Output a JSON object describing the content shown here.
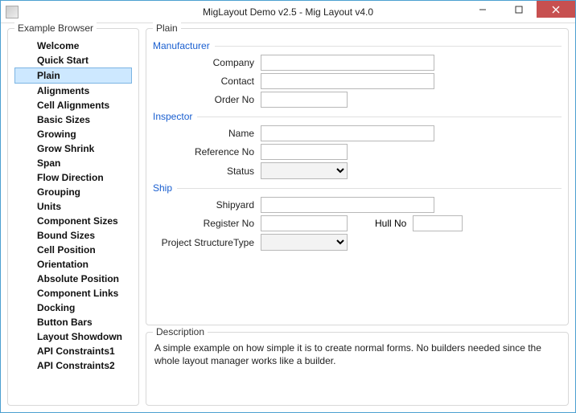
{
  "window": {
    "title": "MigLayout Demo v2.5 - Mig Layout v4.0"
  },
  "sidebar": {
    "legend": "Example Browser",
    "items": [
      "Welcome",
      "Quick Start",
      "Plain",
      "Alignments",
      "Cell Alignments",
      "Basic Sizes",
      "Growing",
      "Grow Shrink",
      "Span",
      "Flow Direction",
      "Grouping",
      "Units",
      "Component Sizes",
      "Bound Sizes",
      "Cell Position",
      "Orientation",
      "Absolute Position",
      "Component Links",
      "Docking",
      "Button Bars",
      "Layout Showdown",
      "API Constraints1",
      "API Constraints2"
    ],
    "selectedIndex": 2
  },
  "plain": {
    "legend": "Plain",
    "manufacturer": {
      "heading": "Manufacturer",
      "company_label": "Company",
      "company_value": "",
      "contact_label": "Contact",
      "contact_value": "",
      "orderno_label": "Order No",
      "orderno_value": ""
    },
    "inspector": {
      "heading": "Inspector",
      "name_label": "Name",
      "name_value": "",
      "refno_label": "Reference No",
      "refno_value": "",
      "status_label": "Status",
      "status_value": ""
    },
    "ship": {
      "heading": "Ship",
      "shipyard_label": "Shipyard",
      "shipyard_value": "",
      "regno_label": "Register No",
      "regno_value": "",
      "hullno_label": "Hull No",
      "hullno_value": "",
      "pst_label": "Project StructureType",
      "pst_value": ""
    }
  },
  "description": {
    "legend": "Description",
    "text": "A simple example on how simple it is to create normal forms. No builders needed since the whole layout manager works like a builder."
  }
}
